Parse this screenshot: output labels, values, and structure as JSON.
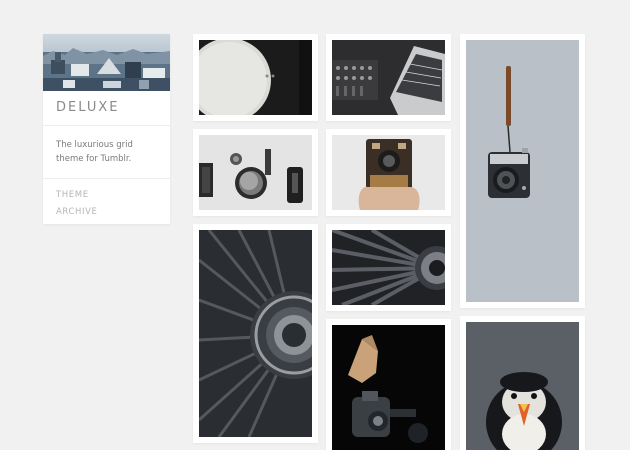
{
  "blog": {
    "title": "DELUXE",
    "description": "The luxurious grid theme for Tumblr.",
    "nav": [
      "THEME",
      "ARCHIVE"
    ]
  },
  "posts": [
    {
      "subject": "turntable-photo"
    },
    {
      "subject": "audio-mixer-and-laptop-photo"
    },
    {
      "subject": "camera-with-leather-strap-photo"
    },
    {
      "subject": "vintage-dials-photo"
    },
    {
      "subject": "box-camera-in-hand-photo"
    },
    {
      "subject": "jet-turbine-photo"
    },
    {
      "subject": "turbine-closeup-photo"
    },
    {
      "subject": "butterfly-on-camera-photo"
    },
    {
      "subject": "puffin-photo"
    }
  ],
  "colors": {
    "background": "#f1f1f1",
    "card": "#ffffff",
    "title": "#8a8a8a",
    "nav": "#b5b5b5"
  }
}
